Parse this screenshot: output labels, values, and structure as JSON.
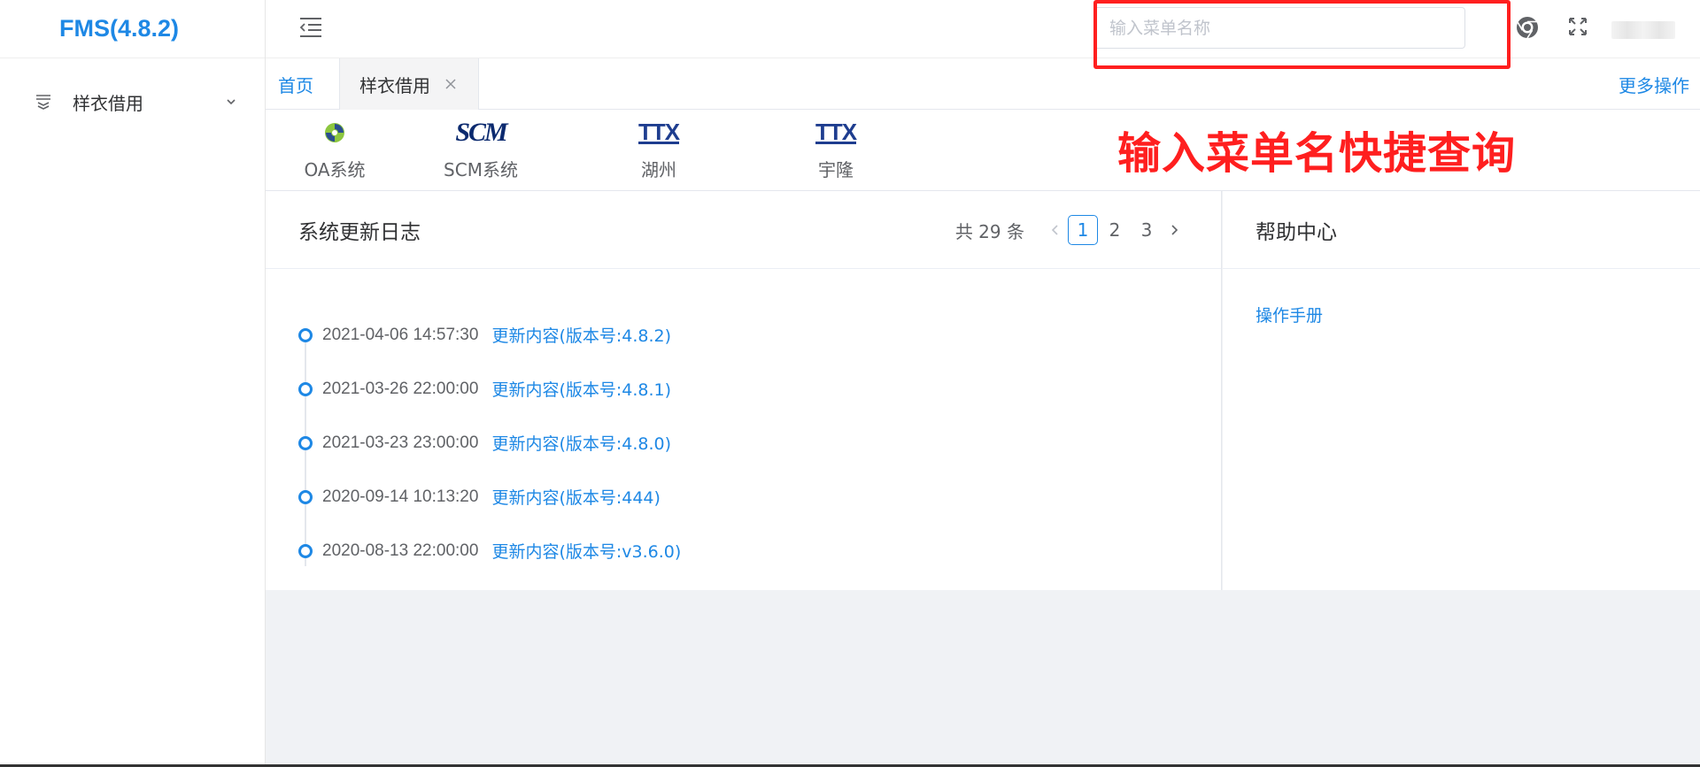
{
  "app": {
    "title": "FMS(4.8.2)"
  },
  "sidebar": {
    "items": [
      {
        "label": "样衣借用",
        "icon": "layers-icon"
      }
    ]
  },
  "header": {
    "search": {
      "placeholder": "输入菜单名称",
      "value": ""
    },
    "icons": [
      "menu-collapse-icon",
      "chrome-icon",
      "fullscreen-icon"
    ]
  },
  "tabs": {
    "home": "首页",
    "items": [
      {
        "label": "样衣借用",
        "close": "×"
      }
    ],
    "more": "更多操作"
  },
  "systems": [
    {
      "label": "OA系统",
      "logo": "oa-logo",
      "text": ""
    },
    {
      "label": "SCM系统",
      "logo": "scm-logo",
      "text": "SCM"
    },
    {
      "label": "湖州",
      "logo": "ttx-logo",
      "text": "TTX"
    },
    {
      "label": "宇隆",
      "logo": "ttx-logo",
      "text": "TTX"
    }
  ],
  "annotation": "输入菜单名快捷查询",
  "log_panel": {
    "title": "系统更新日志",
    "pager": {
      "total": "共 29 条",
      "pages": [
        "1",
        "2",
        "3"
      ],
      "current": "1"
    },
    "entries": [
      {
        "time": "2021-04-06 14:57:30",
        "link": "更新内容(版本号:4.8.2)"
      },
      {
        "time": "2021-03-26 22:00:00",
        "link": "更新内容(版本号:4.8.1)"
      },
      {
        "time": "2021-03-23 23:00:00",
        "link": "更新内容(版本号:4.8.0)"
      },
      {
        "time": "2020-09-14 10:13:20",
        "link": "更新内容(版本号:444)"
      },
      {
        "time": "2020-08-13 22:00:00",
        "link": "更新内容(版本号:v3.6.0)"
      }
    ]
  },
  "help_panel": {
    "title": "帮助中心",
    "links": [
      "操作手册"
    ]
  },
  "colors": {
    "accent": "#1e88e5",
    "annotation": "#ff1f1f",
    "background": "#f0f2f5"
  }
}
